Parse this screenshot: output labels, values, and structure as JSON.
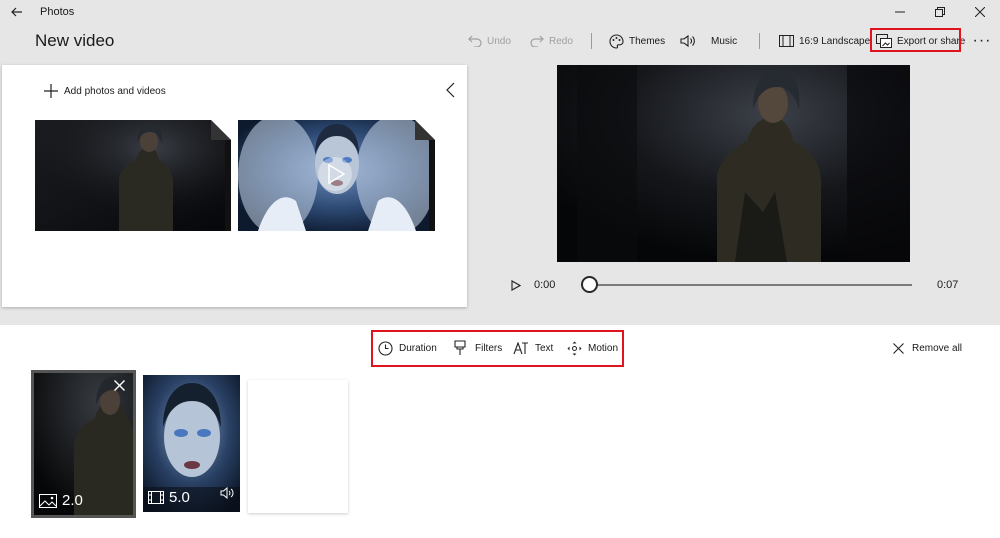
{
  "app": {
    "title": "Photos"
  },
  "project": {
    "title": "New video"
  },
  "toolbar": {
    "undo": "Undo",
    "redo": "Redo",
    "themes": "Themes",
    "music": "Music",
    "aspect": "16:9 Landscape",
    "export": "Export or share"
  },
  "library": {
    "add_label": "Add photos and videos"
  },
  "player": {
    "current_time": "0:00",
    "end_time": "0:07",
    "progress": 0
  },
  "storyboard": {
    "tools": {
      "duration": "Duration",
      "filters": "Filters",
      "text": "Text",
      "motion": "Motion"
    },
    "remove_all": "Remove all",
    "cards": [
      {
        "kind": "photo",
        "duration": "2.0",
        "selected": true
      },
      {
        "kind": "video",
        "duration": "5.0",
        "audio": true
      }
    ]
  },
  "colors": {
    "highlight": "#e0141e",
    "background": "#e6e6e6",
    "panel": "#ffffff"
  }
}
